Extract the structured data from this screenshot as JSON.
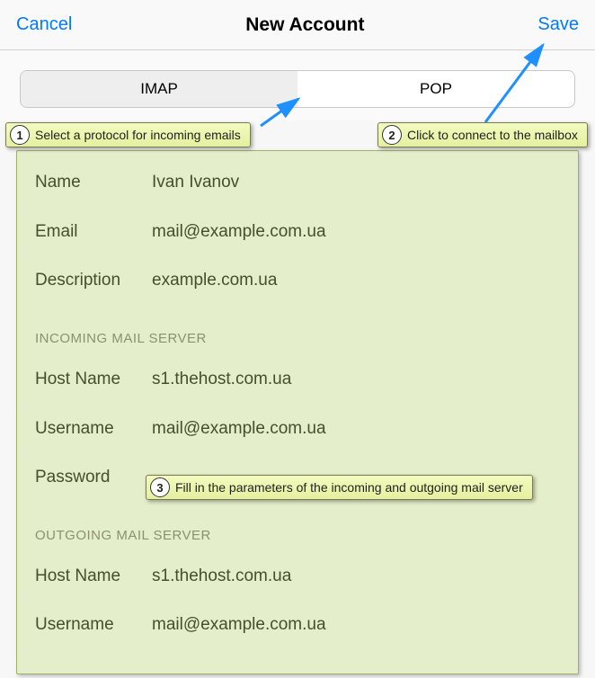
{
  "header": {
    "cancel": "Cancel",
    "title": "New Account",
    "save": "Save"
  },
  "segmented": {
    "imap": "IMAP",
    "pop": "POP"
  },
  "account": {
    "name_label": "Name",
    "name_value": "Ivan Ivanov",
    "email_label": "Email",
    "email_value": "mail@example.com.ua",
    "description_label": "Description",
    "description_value": "example.com.ua"
  },
  "incoming": {
    "section": "INCOMING MAIL SERVER",
    "host_label": "Host Name",
    "host_value": "s1.thehost.com.ua",
    "user_label": "Username",
    "user_value": "mail@example.com.ua",
    "pass_label": "Password"
  },
  "outgoing": {
    "section": "OUTGOING MAIL SERVER",
    "host_label": "Host Name",
    "host_value": "s1.thehost.com.ua",
    "user_label": "Username",
    "user_value": "mail@example.com.ua"
  },
  "callouts": {
    "c1": "Select a protocol for incoming emails",
    "c2": "Click to connect to the mailbox",
    "c3": "Fill in the parameters of the incoming and outgoing mail server"
  }
}
